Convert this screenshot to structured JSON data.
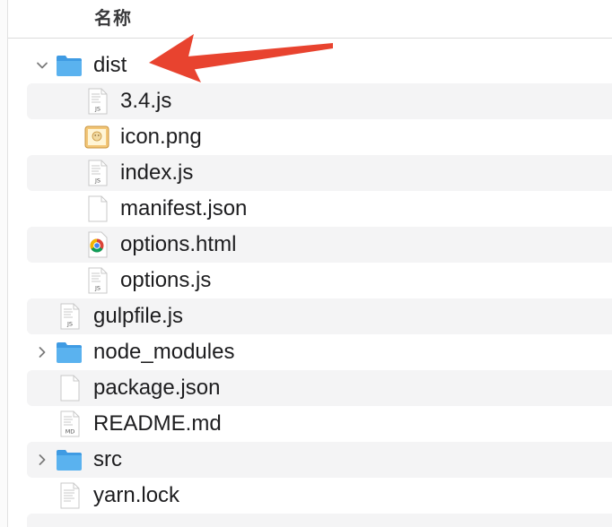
{
  "header": {
    "column_name": "名称"
  },
  "files": [
    {
      "name": "dist",
      "kind": "folder",
      "icon": "folder-icon",
      "level": 0,
      "expanded": true
    },
    {
      "name": "3.4.js",
      "kind": "js",
      "icon": "js-file-icon",
      "level": 1
    },
    {
      "name": "icon.png",
      "kind": "image",
      "icon": "png-image-icon",
      "level": 1
    },
    {
      "name": "index.js",
      "kind": "js",
      "icon": "js-file-icon",
      "level": 1
    },
    {
      "name": "manifest.json",
      "kind": "blank",
      "icon": "json-file-icon",
      "level": 1
    },
    {
      "name": "options.html",
      "kind": "chrome",
      "icon": "chrome-html-icon",
      "level": 1
    },
    {
      "name": "options.js",
      "kind": "js",
      "icon": "js-file-icon",
      "level": 1
    },
    {
      "name": "gulpfile.js",
      "kind": "js",
      "icon": "js-file-icon",
      "level": 0
    },
    {
      "name": "node_modules",
      "kind": "folder",
      "icon": "folder-icon",
      "level": 0,
      "expanded": false
    },
    {
      "name": "package.json",
      "kind": "blank",
      "icon": "json-file-icon",
      "level": 0
    },
    {
      "name": "README.md",
      "kind": "md",
      "icon": "md-file-icon",
      "level": 0
    },
    {
      "name": "src",
      "kind": "folder",
      "icon": "folder-icon",
      "level": 0,
      "expanded": false
    },
    {
      "name": "yarn.lock",
      "kind": "text",
      "icon": "text-file-icon",
      "level": 0
    }
  ],
  "file_badges": {
    "js": "JS",
    "md": "MD"
  },
  "colors": {
    "annotation_arrow": "#e8432f",
    "folder_front": "#5ab2ef",
    "folder_back": "#3f9be3",
    "row_stripe": "#f4f4f5"
  },
  "annotation": {
    "shape": "arrow",
    "points_to": "dist"
  }
}
